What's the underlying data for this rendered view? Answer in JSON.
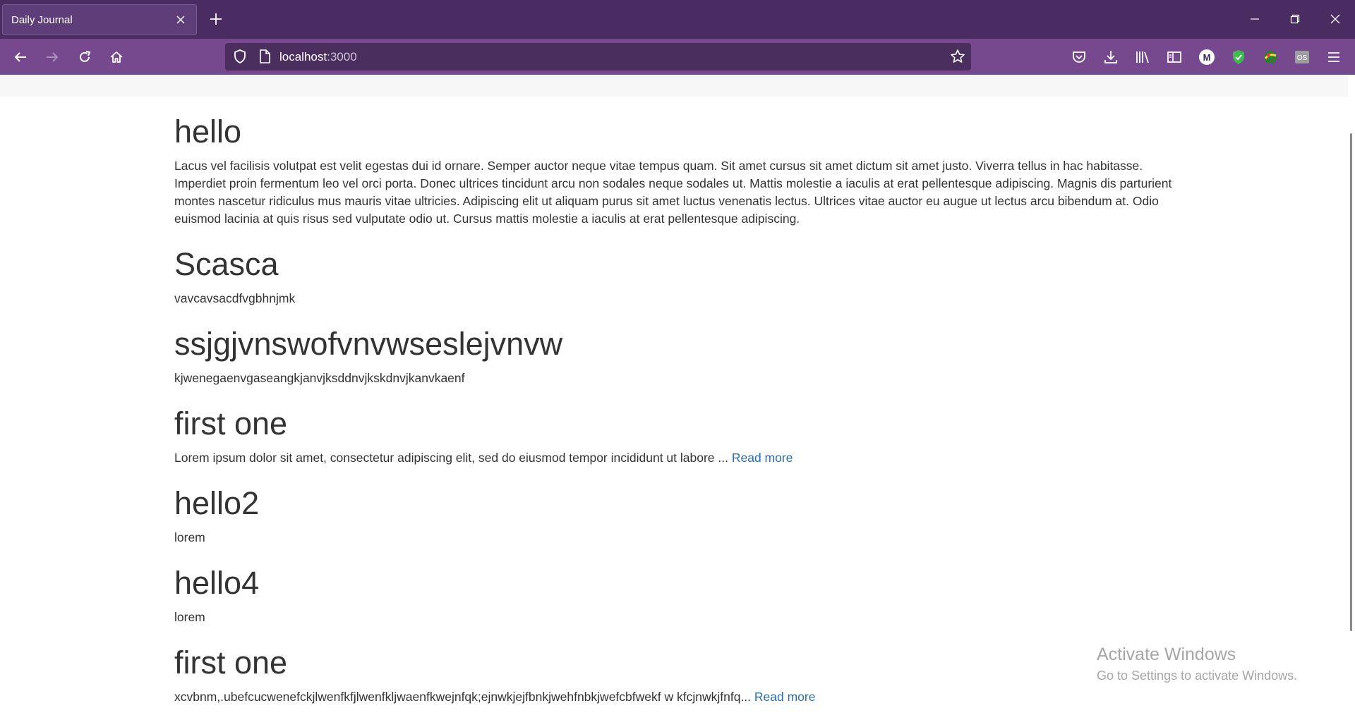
{
  "browser": {
    "tab_title": "Daily Journal",
    "url_host": "localhost",
    "url_port": ":3000"
  },
  "posts": [
    {
      "title": "hello",
      "body": "Lacus vel facilisis volutpat est velit egestas dui id ornare. Semper auctor neque vitae tempus quam. Sit amet cursus sit amet dictum sit amet justo. Viverra tellus in hac habitasse. Imperdiet proin fermentum leo vel orci porta. Donec ultrices tincidunt arcu non sodales neque sodales ut. Mattis molestie a iaculis at erat pellentesque adipiscing. Magnis dis parturient montes nascetur ridiculus mus mauris vitae ultricies. Adipiscing elit ut aliquam purus sit amet luctus venenatis lectus. Ultrices vitae auctor eu augue ut lectus arcu bibendum at. Odio euismod lacinia at quis risus sed vulputate odio ut. Cursus mattis molestie a iaculis at erat pellentesque adipiscing."
    },
    {
      "title": "Scasca",
      "body": "vavcavsacdfvgbhnjmk"
    },
    {
      "title": "ssjgjvnswofvnvwseslejvnvw",
      "body": "kjwenegaenvgaseangkjanvjksddnvjkskdnvjkanvkaenf"
    },
    {
      "title": "first one",
      "body": "Lorem ipsum dolor sit amet, consectetur adipiscing elit, sed do eiusmod tempor incididunt ut labore ... ",
      "link": "Read more"
    },
    {
      "title": "hello2",
      "body": "lorem"
    },
    {
      "title": "hello4",
      "body": "lorem"
    },
    {
      "title": "first one",
      "body": "xcvbnm,.ubefcucwenefckjlwenfkfjlwenfkljwaenfkwejnfqk;ejnwkjejfbnkjwehfnbkjwefcbfwekf w kfcjnwkjfnfq... ",
      "link": "Read more"
    }
  ],
  "watermark": {
    "line1": "Activate Windows",
    "line2": "Go to Settings to activate Windows."
  },
  "colors": {
    "tabbar": "#4b2c62",
    "navbar": "#76498f",
    "link": "#2a6ead"
  }
}
